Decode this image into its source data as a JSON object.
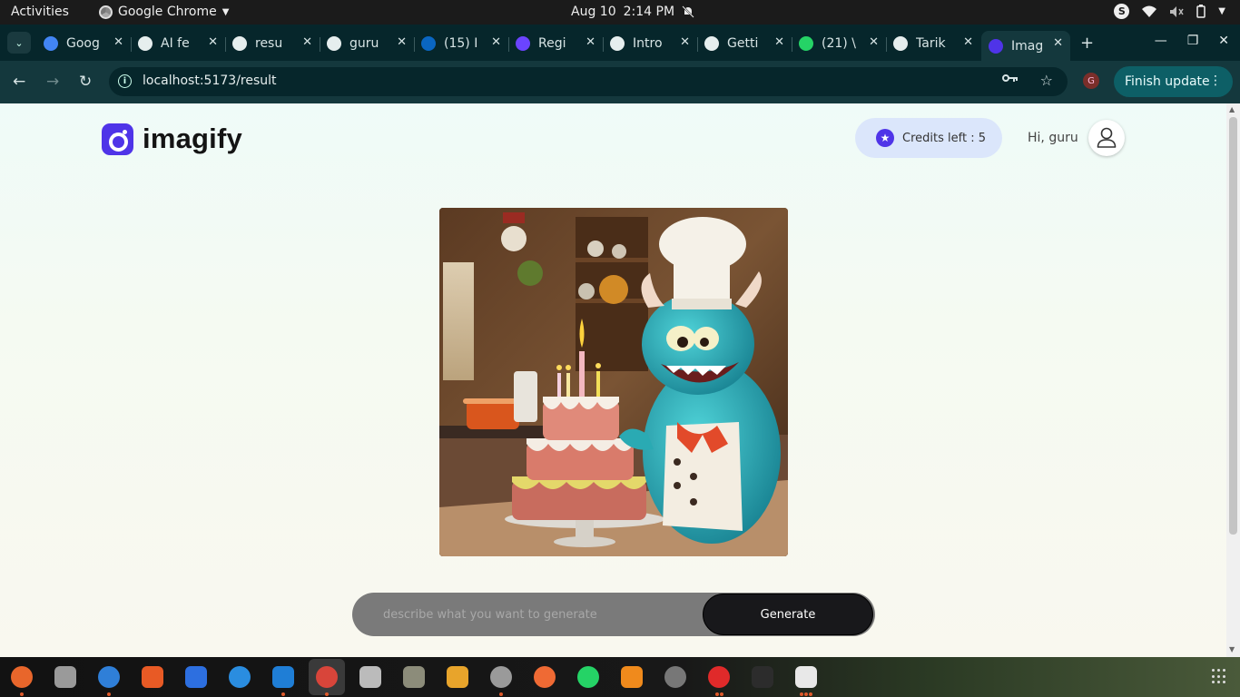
{
  "topbar": {
    "activities": "Activities",
    "app_name": "Google Chrome",
    "date": "Aug 10",
    "time": "2:14 PM"
  },
  "tabs": [
    {
      "label": "Goog",
      "icon": "gemini-icon",
      "color": "#4285f4"
    },
    {
      "label": "AI fe",
      "icon": "six-icon",
      "color": "#e6eeee"
    },
    {
      "label": "resu",
      "icon": "six-icon",
      "color": "#e6eeee"
    },
    {
      "label": "guru",
      "icon": "github-icon",
      "color": "#e6eeee"
    },
    {
      "label": "(15) I",
      "icon": "linkedin-icon",
      "color": "#0a66c2"
    },
    {
      "label": "Regi",
      "icon": "q-icon",
      "color": "#6b44ff"
    },
    {
      "label": "Intro",
      "icon": "openai-icon",
      "color": "#e6eeee"
    },
    {
      "label": "Getti",
      "icon": "openai-icon",
      "color": "#e6eeee"
    },
    {
      "label": "(21) \\",
      "icon": "whatsapp-icon",
      "color": "#25d366"
    },
    {
      "label": "Tarik",
      "icon": "github-icon",
      "color": "#e6eeee"
    },
    {
      "label": "Imag",
      "icon": "imagify-icon",
      "color": "#4f34e8"
    }
  ],
  "address": {
    "url": "localhost:5173/result",
    "profile_initial": "G",
    "finish_update": "Finish update"
  },
  "app": {
    "brand": "imagify",
    "credits_label": "Credits left : 5",
    "greeting": "Hi, guru",
    "prompt_placeholder": "describe what you want to generate",
    "prompt_value": "",
    "generate_label": "Generate",
    "brand_color": "#4f34e8"
  },
  "dock": {
    "apps": [
      "firefox-icon",
      "files-icon",
      "thunderbird-icon",
      "app-center-icon",
      "text-editor-icon",
      "help-icon",
      "vscode-icon",
      "chrome-icon",
      "screenshot-icon",
      "archive-icon",
      "package-icon",
      "settings-icon",
      "postman-icon",
      "whatsapp-icon",
      "vlc-icon",
      "inkscape-icon",
      "update-alert-icon",
      "terminal-icon",
      "text-viewer-icon"
    ]
  }
}
